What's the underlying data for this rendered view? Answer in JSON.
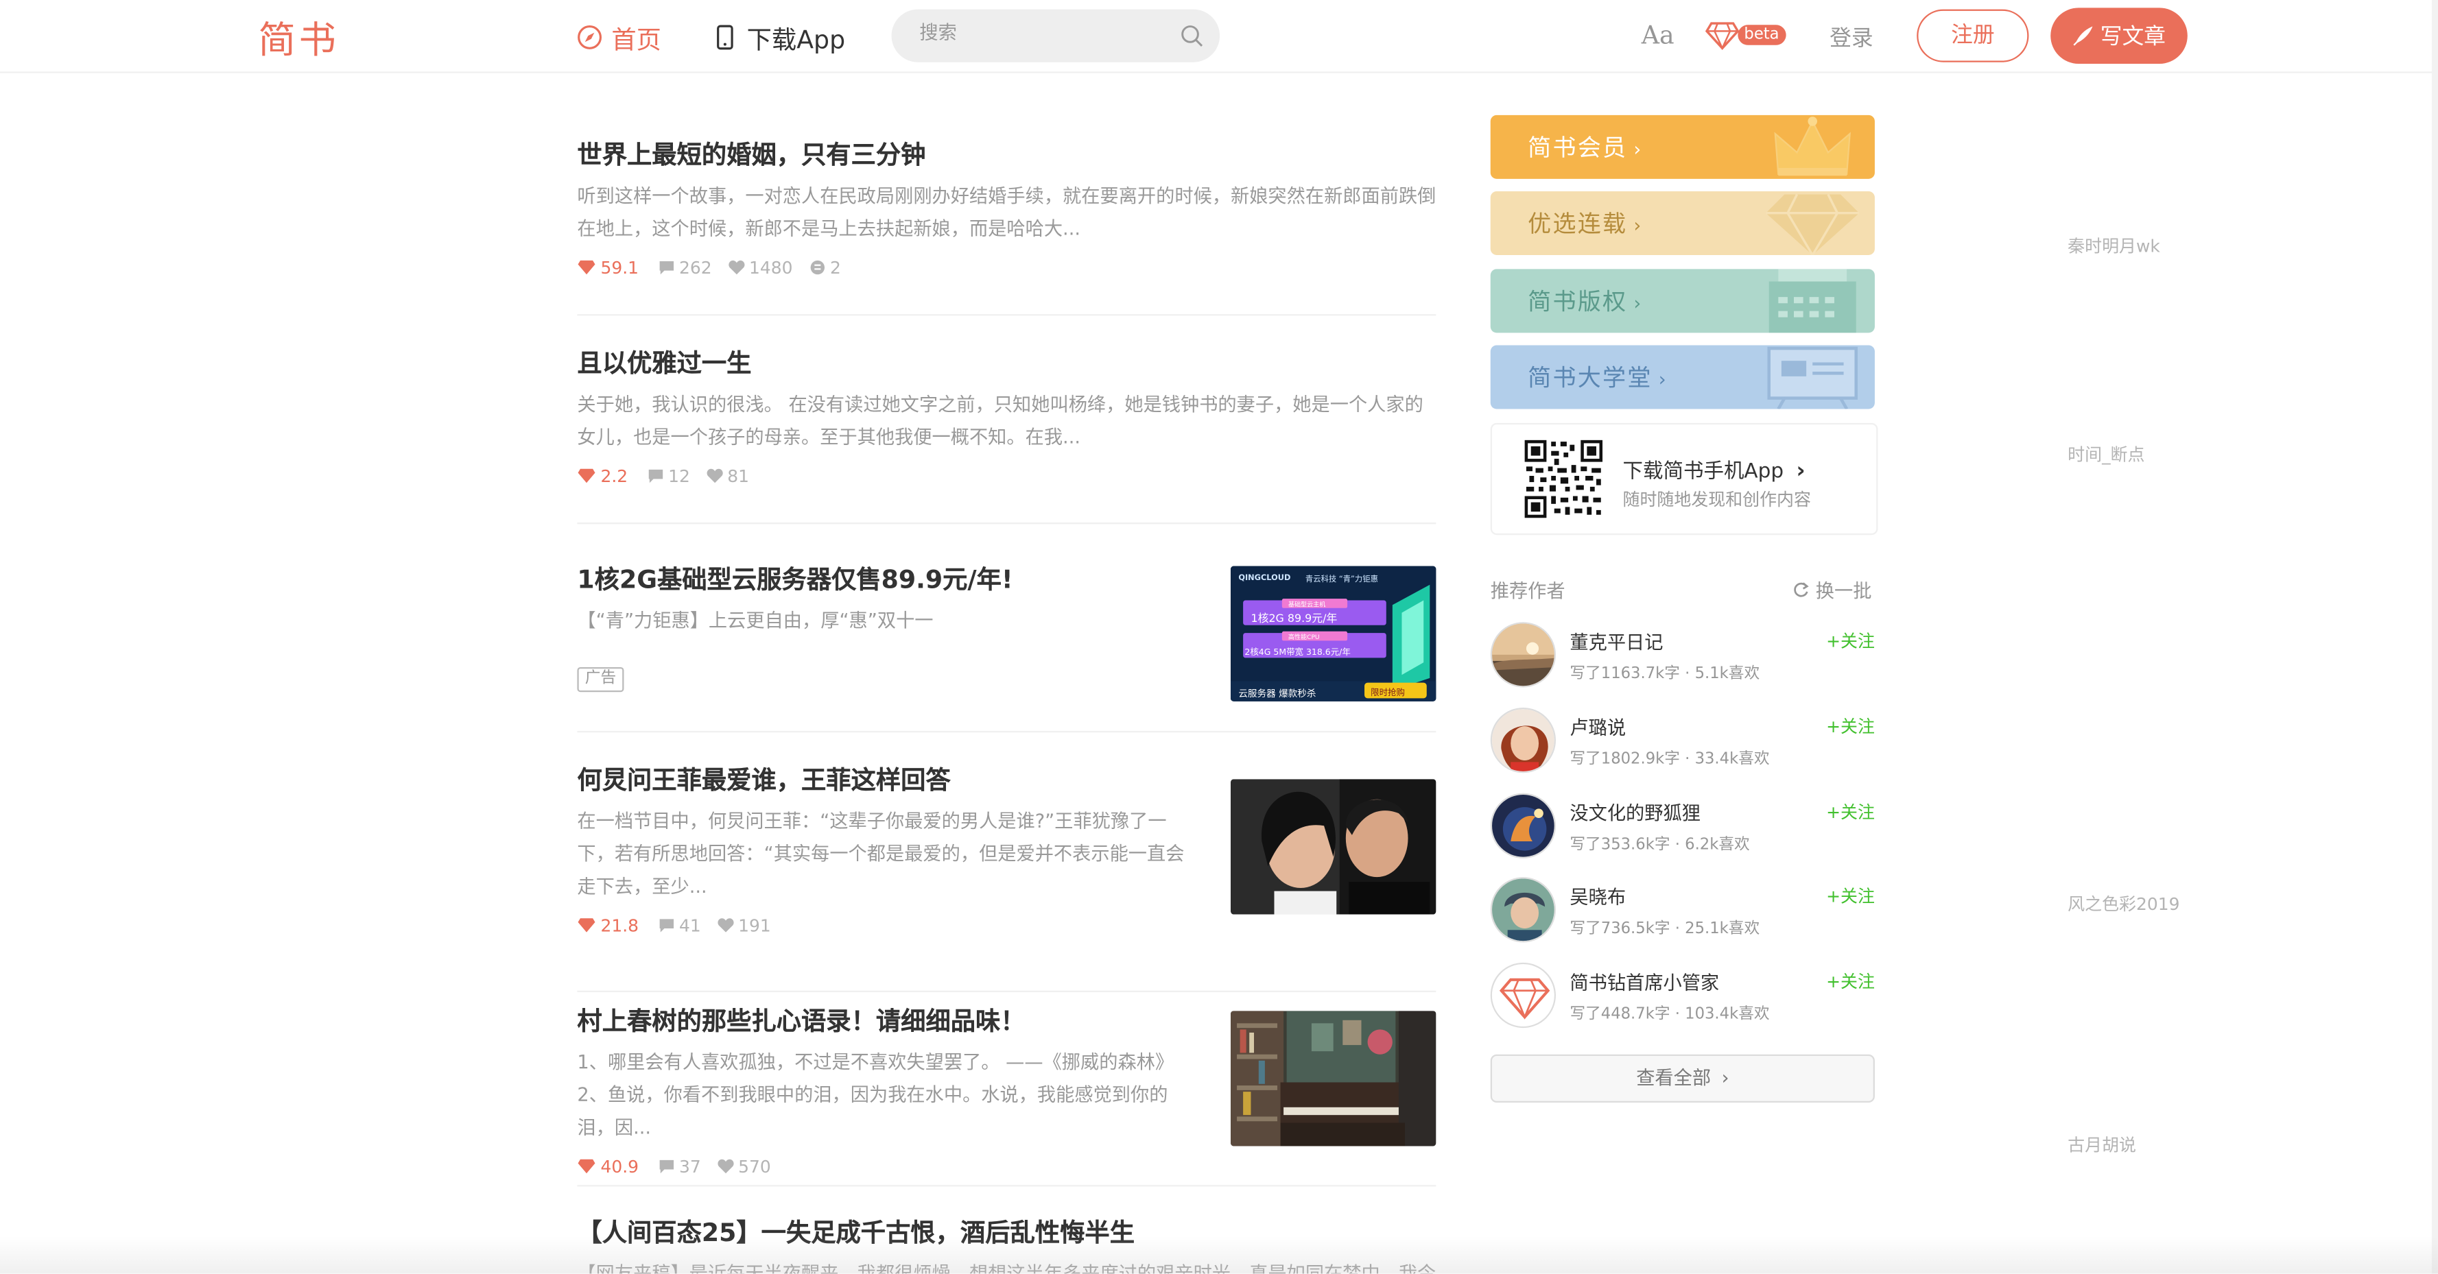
{
  "header": {
    "logo": "简书",
    "nav_home": "首页",
    "nav_app": "下载App",
    "search_placeholder": "搜索",
    "font_toggle": "Aa",
    "beta": "beta",
    "login": "登录",
    "signup": "注册",
    "write": "写文章",
    "accent_color": "#ea6f5a"
  },
  "articles": [
    {
      "title": "世界上最短的婚姻，只有三分钟",
      "abstract": "听到这样一个故事，一对恋人在民政局刚刚办好结婚手续，就在要离开的时候，新娘突然在新郎面前跌倒在地上，这个时候，新郎不是马上去扶起新娘，而是哈哈大...",
      "score": "59.1",
      "author": "秦时明月wk",
      "comments": "262",
      "likes": "1480",
      "rewards": "2"
    },
    {
      "title": "且以优雅过一生",
      "abstract": "关于她，我认识的很浅。 在没有读过她文字之前，只知她叫杨绛，她是钱钟书的妻子，她是一个人家的女儿，也是一个孩子的母亲。至于其他我便一概不知。在我...",
      "score": "2.2",
      "author": "时间_断点",
      "comments": "12",
      "likes": "81"
    },
    {
      "title": "1核2G基础型云服务器仅售89.9元/年!",
      "abstract": "【“青”力钜惠】上云更自由，厚“惠”双十一",
      "ad_label": "广告",
      "ad_image": {
        "brand": "QINGCLOUD",
        "tagline": "青云科技 “青”力钜惠",
        "line1_tag": "基础型云主机",
        "line1": "1核2G  89.9元/年",
        "line2_tag": "高性能CPU",
        "line2": "2核4G 5M带宽 318.6元/年",
        "footer": "云服务器 爆款秒杀",
        "footer_badge": "限时抢购"
      }
    },
    {
      "title": "何炅问王菲最爱谁，王菲这样回答",
      "abstract": "在一档节目中，何炅问王菲：“这辈子你最爱的男人是谁?”王菲犹豫了一下，若有所思地回答：“其实每一个都是最爱的，但是爱并不表示能一直会走下去，至少...",
      "score": "21.8",
      "author": "风之色彩2019",
      "comments": "41",
      "likes": "191"
    },
    {
      "title": "村上春树的那些扎心语录！请细细品味！",
      "abstract": "1、哪里会有人喜欢孤独，不过是不喜欢失望罢了。 ——《挪威的森林》 2、鱼说，你看不到我眼中的泪，因为我在水中。水说，我能感觉到你的泪，因...",
      "score": "40.9",
      "author": "古月胡说",
      "comments": "37",
      "likes": "570"
    },
    {
      "title": "【人间百态25】一失足成千古恨，酒后乱性悔半生",
      "abstract": "【网友来稿】最近每天半夜醒来，我都很烦燥。想想这半年多来度过的艰辛时光，真是如同在梦中。我今年..."
    }
  ],
  "sidebar": {
    "banners": [
      {
        "label": "简书会员",
        "bg": "#f6b44a",
        "icon": "crown-icon"
      },
      {
        "label": "优选连载",
        "bg": "#f5deb0",
        "icon": "diamond-icon"
      },
      {
        "label": "简书版权",
        "bg": "#aed7cb",
        "icon": "typewriter-icon"
      },
      {
        "label": "简书大学堂",
        "bg": "#b2ceea",
        "icon": "blackboard-icon"
      }
    ],
    "app": {
      "title": "下载简书手机App",
      "subtitle": "随时随地发现和创作内容"
    },
    "recommend_title": "推荐作者",
    "refresh": "换一批",
    "follow_label": "+关注",
    "authors": [
      {
        "name": "董克平日记",
        "stats": "写了1163.7k字 · 5.1k喜欢"
      },
      {
        "name": "卢璐说",
        "stats": "写了1802.9k字 · 33.4k喜欢"
      },
      {
        "name": "没文化的野狐狸",
        "stats": "写了353.6k字 · 6.2k喜欢"
      },
      {
        "name": "吴晓布",
        "stats": "写了736.5k字 · 25.1k喜欢"
      },
      {
        "name": "简书钻首席小管家",
        "stats": "写了448.7k字 · 103.4k喜欢"
      }
    ],
    "view_all": "查看全部"
  }
}
